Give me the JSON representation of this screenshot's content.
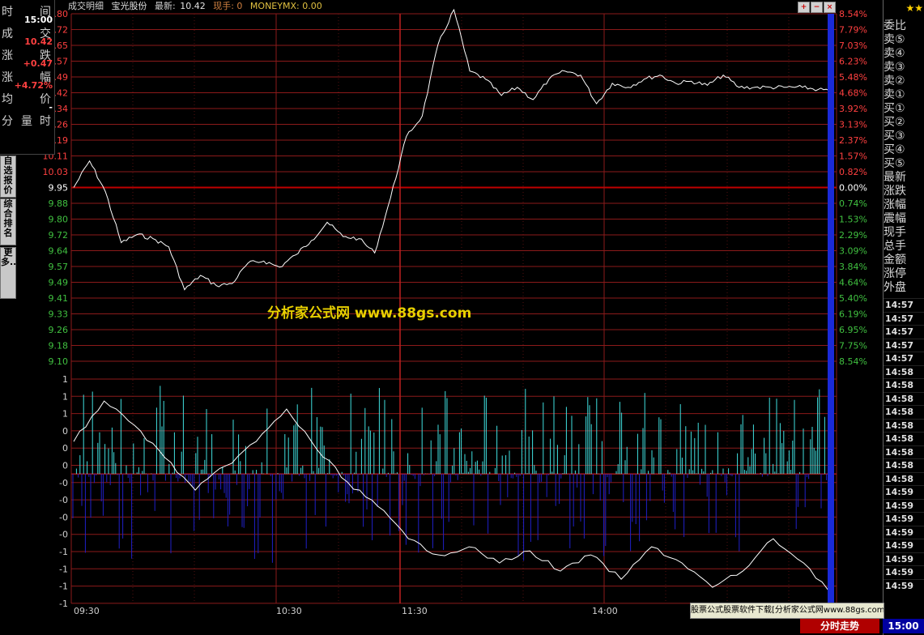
{
  "header": {
    "title": "成交明细",
    "stock_name": "宝光股份",
    "latest_label": "最新:",
    "latest_value": "10.42",
    "current_hand": "现手: 0",
    "indicator": "MONEYMX: 0.00"
  },
  "left_panel": {
    "rows": [
      {
        "a": "时",
        "b": "间",
        "val": "15:00",
        "color": "#ffffff"
      },
      {
        "a": "成",
        "b": "交",
        "val": "10.42",
        "color": "#ff4040"
      },
      {
        "a": "涨",
        "b": "跌",
        "val": "+0.47",
        "color": "#ff4040"
      },
      {
        "a": "涨",
        "b": "幅",
        "val": "+4.72%",
        "color": "#ff4040"
      },
      {
        "a": "均",
        "b": "价",
        "val": "-",
        "color": "#ffffff"
      },
      {
        "a": "分",
        "b": "时",
        "c": "量",
        "val": "",
        "color": "#ffffff"
      }
    ],
    "tabs": [
      "自选报价",
      "综合排名",
      "更多..."
    ]
  },
  "price_axis": {
    "left_labels": [
      "10.80",
      "10.72",
      "10.65",
      "10.57",
      "10.49",
      "10.42",
      "10.34",
      "10.26",
      "10.19",
      "10.11",
      "10.03",
      "9.95",
      "9.88",
      "9.80",
      "9.72",
      "9.64",
      "9.57",
      "9.49",
      "9.41",
      "9.33",
      "9.26",
      "9.18",
      "9.10"
    ],
    "right_labels": [
      "8.54%",
      "7.79%",
      "7.03%",
      "6.23%",
      "5.48%",
      "4.68%",
      "3.92%",
      "3.13%",
      "2.37%",
      "1.57%",
      "0.82%",
      "0.00%",
      "0.74%",
      "1.53%",
      "2.29%",
      "3.09%",
      "3.84%",
      "4.64%",
      "5.40%",
      "6.19%",
      "6.95%",
      "7.75%",
      "8.54%"
    ],
    "prev_close": "9.95"
  },
  "volume_axis": {
    "labels": [
      "1",
      "1",
      "1",
      "0",
      "0",
      "0",
      "-0",
      "-0",
      "-0",
      "-0",
      "-1",
      "-1",
      "-1",
      "-1"
    ]
  },
  "time_axis": {
    "labels": [
      "09:30",
      "10:30",
      "11:30",
      "14:00"
    ]
  },
  "right_panel": {
    "labels": [
      "委比",
      "卖⑤",
      "卖④",
      "卖③",
      "卖②",
      "卖①",
      "买①",
      "买②",
      "买③",
      "买④",
      "买⑤",
      "最新",
      "涨跌",
      "涨幅",
      "震幅",
      "现手",
      "总手",
      "金额",
      "涨停",
      "外盘"
    ],
    "times": [
      "14:57",
      "14:57",
      "14:57",
      "14:57",
      "14:57",
      "14:58",
      "14:58",
      "14:58",
      "14:58",
      "14:58",
      "14:58",
      "14:58",
      "14:58",
      "14:58",
      "14:59",
      "14:59",
      "14:59",
      "14:59",
      "14:59",
      "14:59",
      "14:59",
      "14:59"
    ]
  },
  "watermark": "分析家公式网 www.88gs.com",
  "ad_bar": "股票公式股票软件下载[分析家公式网www.88gs.com]",
  "bottom_tabs": {
    "trend": "分时走势",
    "time": "15:00"
  },
  "colors": {
    "grid": "#8b1a1a",
    "price_line": "#ffffff",
    "up_bar": "#40e0e0",
    "down_bar": "#2020c8",
    "zero_line": "#c00000",
    "up_text": "#ff4040",
    "down_text": "#40c040"
  },
  "chart_data": {
    "type": "line",
    "title": "宝光股份",
    "price_series": {
      "name": "price",
      "x": [
        "09:30",
        "09:35",
        "09:40",
        "09:45",
        "09:50",
        "09:55",
        "10:00",
        "10:05",
        "10:10",
        "10:15",
        "10:20",
        "10:25",
        "10:30",
        "10:35",
        "10:40",
        "10:45",
        "10:50",
        "10:55",
        "11:00",
        "11:05",
        "11:10",
        "11:15",
        "11:20",
        "11:25",
        "11:30",
        "13:05",
        "13:10",
        "13:15",
        "13:20",
        "13:25",
        "13:30",
        "13:35",
        "13:40",
        "13:45",
        "13:50",
        "13:55",
        "14:00",
        "14:05",
        "14:10",
        "14:15",
        "14:20",
        "14:25",
        "14:30",
        "14:35",
        "14:40",
        "14:45",
        "14:50",
        "14:55",
        "15:00"
      ],
      "values": [
        9.95,
        10.08,
        9.93,
        9.68,
        9.72,
        9.7,
        9.66,
        9.45,
        9.52,
        9.47,
        9.48,
        9.58,
        9.59,
        9.56,
        9.62,
        9.69,
        9.78,
        9.71,
        9.7,
        9.63,
        9.9,
        10.2,
        10.3,
        10.65,
        10.82,
        10.52,
        10.48,
        10.4,
        10.44,
        10.38,
        10.48,
        10.52,
        10.5,
        10.36,
        10.46,
        10.44,
        10.48,
        10.5,
        10.46,
        10.47,
        10.45,
        10.5,
        10.44,
        10.44,
        10.44,
        10.44,
        10.44,
        10.43,
        10.42
      ]
    },
    "ylim": [
      9.1,
      10.8
    ],
    "prev_close": 9.95
  }
}
